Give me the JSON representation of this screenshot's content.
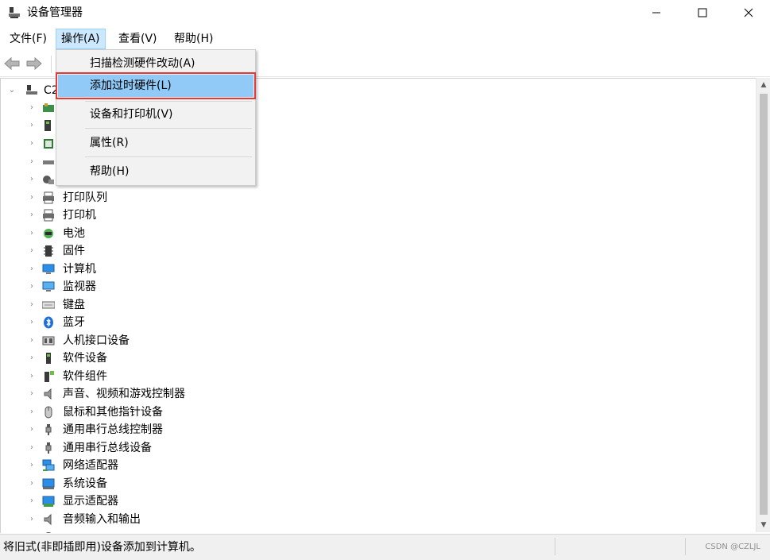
{
  "window": {
    "title": "设备管理器",
    "icon": "device-manager-icon"
  },
  "menubar": {
    "items": [
      {
        "label": "文件(F)"
      },
      {
        "label": "操作(A)"
      },
      {
        "label": "查看(V)"
      },
      {
        "label": "帮助(H)"
      }
    ]
  },
  "toolbar": {
    "back_icon": "arrow-left-icon",
    "forward_icon": "arrow-right-icon"
  },
  "tree": {
    "root_label": "C2",
    "items": [
      {
        "label": "打印队列",
        "icon": "print-queue-icon"
      },
      {
        "label": "打印机",
        "icon": "printer-icon"
      },
      {
        "label": "电池",
        "icon": "battery-icon"
      },
      {
        "label": "固件",
        "icon": "firmware-icon"
      },
      {
        "label": "计算机",
        "icon": "computer-icon"
      },
      {
        "label": "监视器",
        "icon": "monitor-icon"
      },
      {
        "label": "键盘",
        "icon": "keyboard-icon"
      },
      {
        "label": "蓝牙",
        "icon": "bluetooth-icon"
      },
      {
        "label": "人机接口设备",
        "icon": "hid-icon"
      },
      {
        "label": "软件设备",
        "icon": "software-device-icon"
      },
      {
        "label": "软件组件",
        "icon": "software-component-icon"
      },
      {
        "label": "声音、视频和游戏控制器",
        "icon": "speaker-icon"
      },
      {
        "label": "鼠标和其他指针设备",
        "icon": "mouse-icon"
      },
      {
        "label": "通用串行总线控制器",
        "icon": "usb-icon"
      },
      {
        "label": "通用串行总线设备",
        "icon": "usb-device-icon"
      },
      {
        "label": "网络适配器",
        "icon": "network-adapter-icon"
      },
      {
        "label": "系统设备",
        "icon": "system-device-icon"
      },
      {
        "label": "显示适配器",
        "icon": "display-adapter-icon"
      },
      {
        "label": "音频输入和输出",
        "icon": "audio-io-icon"
      }
    ]
  },
  "dropdown": {
    "items": [
      {
        "label": "扫描检测硬件改动(A)"
      },
      {
        "label": "添加过时硬件(L)"
      },
      {
        "label": "设备和打印机(V)"
      },
      {
        "label": "属性(R)"
      },
      {
        "label": "帮助(H)"
      }
    ]
  },
  "statusbar": {
    "text": "将旧式(非即插即用)设备添加到计算机。",
    "watermark": "CSDN @CZLJL"
  },
  "colors": {
    "highlight": "#91c9f7",
    "highlight_outline": "#e53935",
    "menu_active": "#cce8ff"
  }
}
